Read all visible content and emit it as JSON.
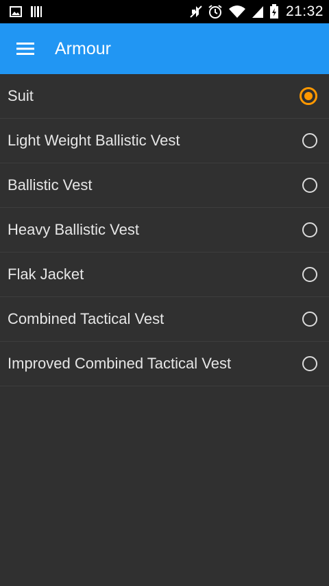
{
  "status_bar": {
    "time": "21:32",
    "left_icons": [
      "image-icon",
      "barcode-icon"
    ],
    "right_icons": [
      "mute-icon",
      "alarm-icon",
      "wifi-icon",
      "signal-icon",
      "battery-icon"
    ]
  },
  "app_bar": {
    "title": "Armour",
    "menu_icon": "hamburger-menu-icon",
    "color": "#2196f3"
  },
  "options": {
    "selected_index": 0,
    "accent_color": "#ff9800",
    "items": [
      {
        "label": "Suit",
        "checked": true
      },
      {
        "label": "Light Weight Ballistic Vest",
        "checked": false
      },
      {
        "label": "Ballistic Vest",
        "checked": false
      },
      {
        "label": "Heavy Ballistic Vest",
        "checked": false
      },
      {
        "label": "Flak Jacket",
        "checked": false
      },
      {
        "label": "Combined Tactical Vest",
        "checked": false
      },
      {
        "label": "Improved Combined Tactical Vest",
        "checked": false
      }
    ]
  }
}
